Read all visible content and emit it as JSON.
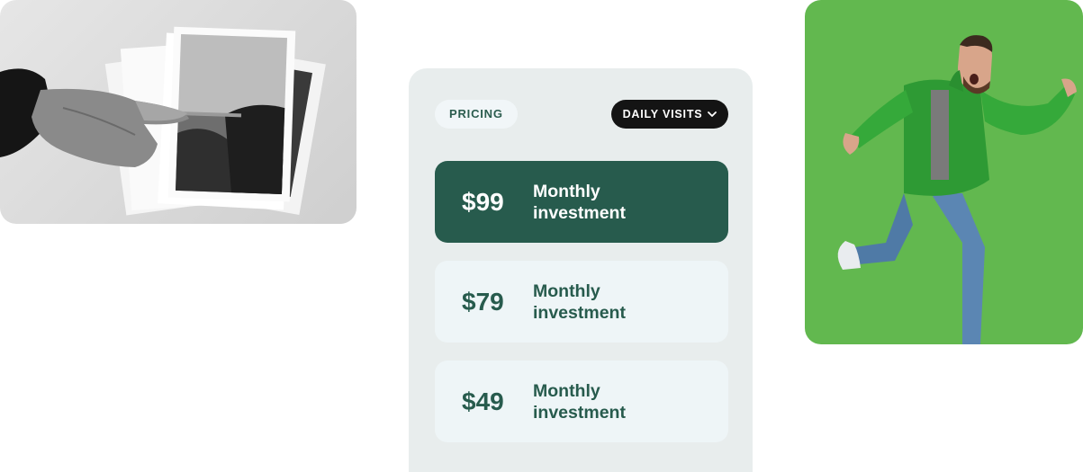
{
  "pricing": {
    "badge": "PRICING",
    "dropdown": {
      "selected": "DAILY VISITS",
      "icon": "chevron-down-icon"
    },
    "plans": [
      {
        "price": "$99",
        "label": "Monthly investment",
        "active": true
      },
      {
        "price": "$79",
        "label": "Monthly investment",
        "active": false
      },
      {
        "price": "$49",
        "label": "Monthly investment",
        "active": false
      }
    ]
  },
  "colors": {
    "accent": "#275b4d",
    "panel_bg": "#e8eded",
    "plan_bg": "#eef5f7",
    "dropdown_bg": "#141414",
    "photo_right_bg": "#62b84f"
  }
}
